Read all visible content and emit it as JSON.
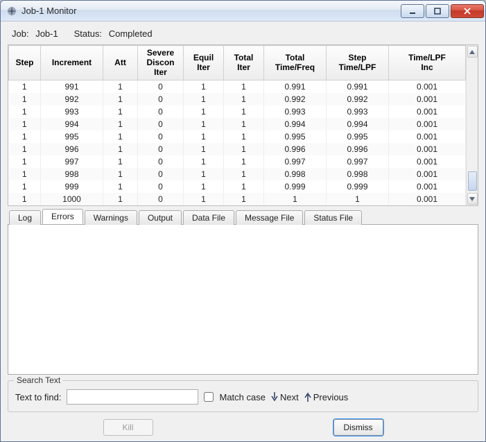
{
  "window": {
    "title": "Job-1 Monitor"
  },
  "jobbar": {
    "job_label": "Job:",
    "job_value": "Job-1",
    "status_label": "Status:",
    "status_value": "Completed"
  },
  "columns": [
    "Step",
    "Increment",
    "Att",
    "Severe\nDiscon\nIter",
    "Equil\nIter",
    "Total\nIter",
    "Total\nTime/Freq",
    "Step\nTime/LPF",
    "Time/LPF\nInc"
  ],
  "rows": [
    [
      "1",
      "991",
      "1",
      "0",
      "1",
      "1",
      "0.991",
      "0.991",
      "0.001"
    ],
    [
      "1",
      "992",
      "1",
      "0",
      "1",
      "1",
      "0.992",
      "0.992",
      "0.001"
    ],
    [
      "1",
      "993",
      "1",
      "0",
      "1",
      "1",
      "0.993",
      "0.993",
      "0.001"
    ],
    [
      "1",
      "994",
      "1",
      "0",
      "1",
      "1",
      "0.994",
      "0.994",
      "0.001"
    ],
    [
      "1",
      "995",
      "1",
      "0",
      "1",
      "1",
      "0.995",
      "0.995",
      "0.001"
    ],
    [
      "1",
      "996",
      "1",
      "0",
      "1",
      "1",
      "0.996",
      "0.996",
      "0.001"
    ],
    [
      "1",
      "997",
      "1",
      "0",
      "1",
      "1",
      "0.997",
      "0.997",
      "0.001"
    ],
    [
      "1",
      "998",
      "1",
      "0",
      "1",
      "1",
      "0.998",
      "0.998",
      "0.001"
    ],
    [
      "1",
      "999",
      "1",
      "0",
      "1",
      "1",
      "0.999",
      "0.999",
      "0.001"
    ],
    [
      "1",
      "1000",
      "1",
      "0",
      "1",
      "1",
      "1",
      "1",
      "0.001"
    ]
  ],
  "tabs": [
    {
      "id": "log",
      "label": "Log"
    },
    {
      "id": "errors",
      "label": "Errors"
    },
    {
      "id": "warnings",
      "label": "Warnings"
    },
    {
      "id": "output",
      "label": "Output"
    },
    {
      "id": "datafile",
      "label": "Data File"
    },
    {
      "id": "msgfile",
      "label": "Message File"
    },
    {
      "id": "statusfile",
      "label": "Status File"
    }
  ],
  "active_tab": "errors",
  "search": {
    "legend": "Search Text",
    "find_label": "Text to find:",
    "find_value": "",
    "match_label": "Match case",
    "next_label": "Next",
    "prev_label": "Previous"
  },
  "buttons": {
    "kill": "Kill",
    "dismiss": "Dismiss"
  }
}
